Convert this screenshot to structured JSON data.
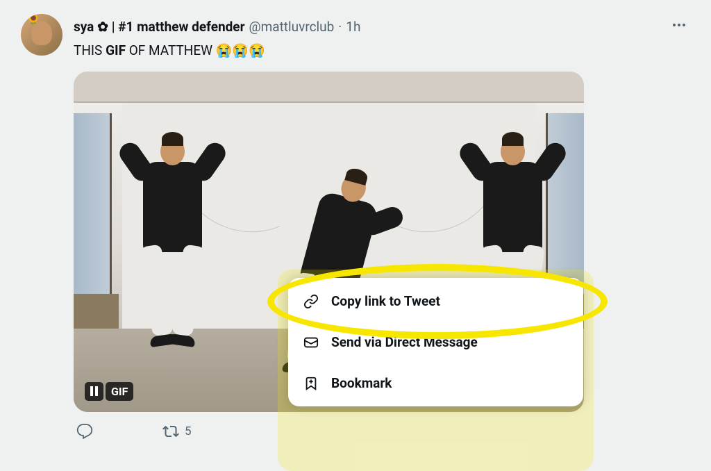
{
  "tweet": {
    "display_name": "sya ✿ | #1 matthew defender",
    "username": "@mattluvrclub",
    "timestamp": "1h",
    "separator": "·",
    "text_prefix": "THIS ",
    "text_bold": "GIF",
    "text_suffix": " OF MATTHEW 😭😭😭"
  },
  "media": {
    "pause_label": "II",
    "gif_label": "GIF"
  },
  "actions": {
    "retweet_count": "5"
  },
  "share_menu": {
    "copy_link": "Copy link to Tweet",
    "send_dm": "Send via Direct Message",
    "bookmark": "Bookmark"
  }
}
